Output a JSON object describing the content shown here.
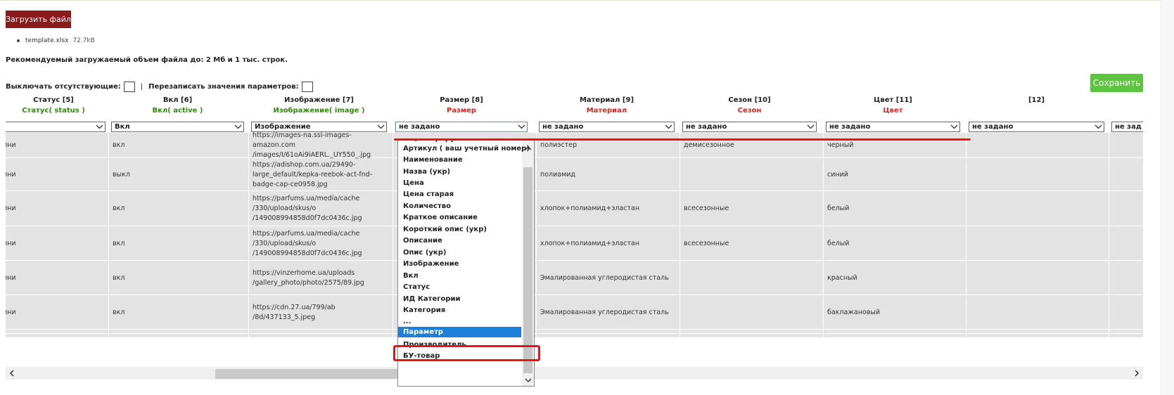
{
  "upload_button": "Загрузить файл",
  "file": {
    "name": "template.xlsx",
    "size": "72.7kB"
  },
  "note": "Рекомендуемый загружаемый объем файла до: 2 Мб и 1 тыс. строк.",
  "options": {
    "disable_missing": "Выключать отсутствующие:",
    "separator": "|",
    "overwrite_params": "Перезаписать значения параметров:"
  },
  "save_button": "Сохранить",
  "columns": [
    {
      "header": "Статус [5]",
      "mapped": "Статус( status )",
      "mapped_color": "green",
      "select": ""
    },
    {
      "header": "Вкл [6]",
      "mapped": "Вкл( active )",
      "mapped_color": "green",
      "select": "Вкл"
    },
    {
      "header": "Изображение [7]",
      "mapped": "Изображение( image )",
      "mapped_color": "green",
      "select": "Изображение"
    },
    {
      "header": "Размер [8]",
      "mapped": "Размер",
      "mapped_color": "red",
      "select": "не задано"
    },
    {
      "header": "Материал [9]",
      "mapped": "Материал",
      "mapped_color": "red",
      "select": "не задано"
    },
    {
      "header": "Сезон [10]",
      "mapped": "Сезон",
      "mapped_color": "red",
      "select": "не задано"
    },
    {
      "header": "Цвет [11]",
      "mapped": "Цвет",
      "mapped_color": "red",
      "select": "не задано"
    },
    {
      "header": "[12]",
      "mapped": "",
      "mapped_color": "",
      "select": "не задано"
    },
    {
      "header": "",
      "mapped": "",
      "mapped_color": "",
      "select": "не зад"
    }
  ],
  "rows": [
    {
      "status": "ини",
      "active": "вкл",
      "image": "https://images-na.ssl-images-amazon.com /images/I/61oAi9iAERL._UY550_.jpg",
      "material": "полиэстер",
      "season": "демисезонное",
      "color": "черный"
    },
    {
      "status": "ини",
      "active": "выкл",
      "image": "https://adishop.com.ua/29490-large_default/kepka-reebok-act-fnd-badge-cap-ce0958.jpg",
      "material": "полиамид",
      "season": "",
      "color": "синий"
    },
    {
      "status": "ини",
      "active": "вкл",
      "image": "https://parfums.ua/media/cache /330/upload/skus/o /149008994858d0f7dc0436c.jpg",
      "material": "хлопок+полиамид+эластан",
      "season": "всесезонные",
      "color": "белый"
    },
    {
      "status": "ини",
      "active": "вкл",
      "image": "https://parfums.ua/media/cache /330/upload/skus/o /149008994858d0f7dc0436c.jpg",
      "material": "хлопок+полиамид+эластан",
      "season": "всесезонные",
      "color": "белый"
    },
    {
      "status": "ини",
      "active": "вкл",
      "image": "https://vinzerhome.ua/uploads /gallery_photo/photo/2575/89.jpg",
      "material": "Эмалированная углеродистая сталь",
      "season": "",
      "color": "красный"
    },
    {
      "status": "ини",
      "active": "вкл",
      "image": "https://cdn.27.ua/799/ab /8d/437133_5.jpeg",
      "material": "Эмалированная углеродистая сталь",
      "season": "",
      "color": "баклажановый"
    }
  ],
  "dropdown": {
    "items": [
      "ID (генерируется автоматически)",
      "Артикул ( ваш учетный номер)",
      "Наименование",
      "Назва (укр)",
      "Цена",
      "Цена старая",
      "Количество",
      "Краткое описание",
      "Короткий опис (укр)",
      "Описание",
      "Опис (укр)",
      "Изображение",
      "Вкл",
      "Статус",
      "ИД Категории",
      "Категория",
      "...",
      "Параметр",
      "Производитель",
      "БУ-товар"
    ],
    "selected_index": 17
  },
  "colors": {
    "upload_bg": "#8b1a1a",
    "save_bg": "#5cc43f",
    "highlight": "#e8141c",
    "selected_bg": "#1e7fd8",
    "mapped_green": "#2e8b0a",
    "mapped_red": "#e02222"
  }
}
